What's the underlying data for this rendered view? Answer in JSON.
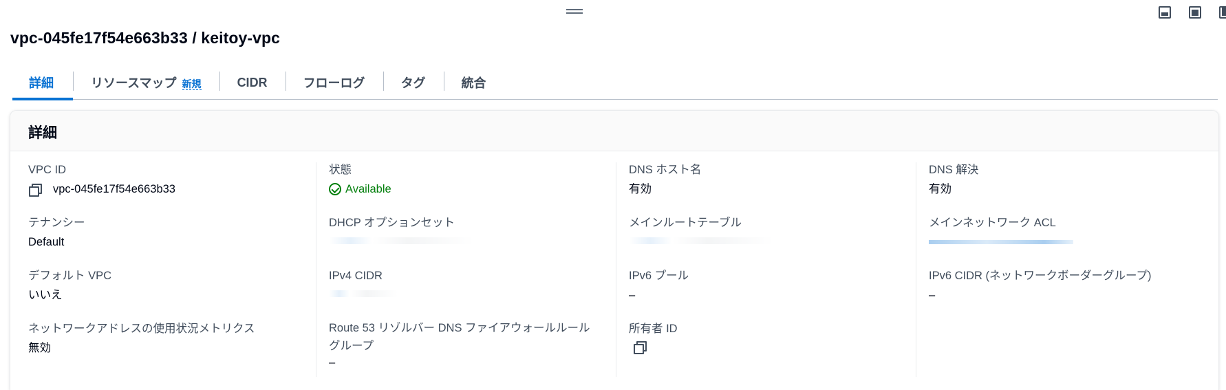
{
  "header": {
    "title": "vpc-045fe17f54e663b33 / keitoy-vpc",
    "panel_icons": [
      "panel-bottom-icon",
      "panel-side-icon",
      "panel-right-icon"
    ]
  },
  "tabs": [
    {
      "label": "詳細",
      "active": true
    },
    {
      "label": "リソースマップ",
      "badge": "新規"
    },
    {
      "label": "CIDR"
    },
    {
      "label": "フローログ"
    },
    {
      "label": "タグ"
    },
    {
      "label": "統合"
    }
  ],
  "details": {
    "heading": "詳細",
    "vpc_id": {
      "label": "VPC ID",
      "value": "vpc-045fe17f54e663b33"
    },
    "state": {
      "label": "状態",
      "value": "Available"
    },
    "dns_hostnames": {
      "label": "DNS ホスト名",
      "value": "有効"
    },
    "dns_resolution": {
      "label": "DNS 解決",
      "value": "有効"
    },
    "tenancy": {
      "label": "テナンシー",
      "value": "Default"
    },
    "dhcp_options": {
      "label": "DHCP オプションセット"
    },
    "main_route_table": {
      "label": "メインルートテーブル"
    },
    "main_network_acl": {
      "label": "メインネットワーク ACL"
    },
    "default_vpc": {
      "label": "デフォルト VPC",
      "value": "いいえ"
    },
    "ipv4_cidr": {
      "label": "IPv4 CIDR"
    },
    "ipv6_pool": {
      "label": "IPv6 プール",
      "value": "–"
    },
    "ipv6_cidr": {
      "label": "IPv6 CIDR (ネットワークボーダーグループ)",
      "value": "–"
    },
    "network_address_usage": {
      "label": "ネットワークアドレスの使用状況メトリクス",
      "value": "無効"
    },
    "route53_resolver": {
      "label": "Route 53 リゾルバー DNS ファイアウォールルールグループ",
      "value": "–"
    },
    "owner_id": {
      "label": "所有者 ID"
    }
  },
  "colors": {
    "accent": "#0972d3",
    "success": "#037f0c",
    "text": "#000716"
  }
}
